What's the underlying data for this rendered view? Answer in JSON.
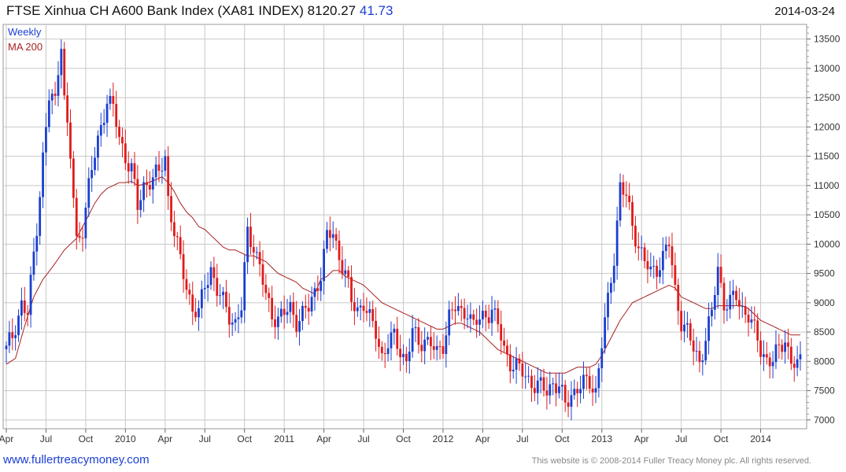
{
  "header": {
    "title": "FTSE Xinhua CH A600 Bank Index (XA81 INDEX) 8120.27",
    "change": "41.73",
    "date": "2014-03-24"
  },
  "footer": {
    "link": "www.fullertreacymoney.com",
    "copyright": "This website is © 2008-2014 Fuller Treacy Money plc. All rights reserved."
  },
  "colors": {
    "up": "#1a3fd0",
    "down": "#e01b1b",
    "ma": "#a82020",
    "grid": "#c8c8c8"
  },
  "chart_data": {
    "type": "line",
    "legend": [
      "Weekly",
      "MA 200"
    ],
    "legend_position": "top-left",
    "grid": true,
    "ylim": [
      6850,
      13750
    ],
    "y_ticks": [
      7000,
      7500,
      8000,
      8500,
      9000,
      9500,
      10000,
      10500,
      11000,
      11500,
      12000,
      12500,
      13000,
      13500
    ],
    "x_labels": [
      "Apr",
      "Jul",
      "Oct",
      "2010",
      "Apr",
      "Jul",
      "Oct",
      "2011",
      "Apr",
      "Jul",
      "Oct",
      "2012",
      "Apr",
      "Jul",
      "Oct",
      "2013",
      "Apr",
      "Jul",
      "Oct",
      "2014"
    ],
    "x_label_weeks": [
      0,
      13,
      26,
      39,
      52,
      65,
      78,
      91,
      104,
      117,
      130,
      143,
      156,
      169,
      182,
      195,
      208,
      221,
      234,
      247
    ],
    "weeks_total": 261,
    "series": [
      {
        "name": "Weekly",
        "anchors": [
          [
            0,
            8200
          ],
          [
            2,
            8400
          ],
          [
            5,
            9000
          ],
          [
            7,
            8800
          ],
          [
            10,
            10300
          ],
          [
            12,
            11500
          ],
          [
            14,
            12500
          ],
          [
            16,
            12400
          ],
          [
            17,
            13000
          ],
          [
            18,
            13500
          ],
          [
            19,
            12500
          ],
          [
            21,
            11500
          ],
          [
            23,
            10000
          ],
          [
            25,
            10300
          ],
          [
            27,
            11000
          ],
          [
            29,
            11500
          ],
          [
            31,
            12000
          ],
          [
            33,
            12500
          ],
          [
            35,
            12300
          ],
          [
            37,
            11800
          ],
          [
            39,
            11500
          ],
          [
            41,
            11300
          ],
          [
            43,
            10600
          ],
          [
            45,
            11000
          ],
          [
            47,
            11100
          ],
          [
            50,
            11200
          ],
          [
            52,
            11500
          ],
          [
            53,
            10800
          ],
          [
            55,
            10200
          ],
          [
            57,
            9700
          ],
          [
            59,
            9300
          ],
          [
            61,
            8900
          ],
          [
            63,
            8800
          ],
          [
            65,
            9300
          ],
          [
            67,
            9600
          ],
          [
            69,
            9200
          ],
          [
            71,
            9000
          ],
          [
            73,
            8800
          ],
          [
            75,
            8650
          ],
          [
            77,
            8900
          ],
          [
            79,
            10200
          ],
          [
            81,
            10000
          ],
          [
            83,
            9600
          ],
          [
            85,
            9100
          ],
          [
            87,
            8800
          ],
          [
            89,
            8750
          ],
          [
            91,
            8800
          ],
          [
            93,
            8900
          ],
          [
            95,
            8700
          ],
          [
            97,
            8800
          ],
          [
            99,
            8900
          ],
          [
            101,
            9200
          ],
          [
            103,
            9500
          ],
          [
            105,
            10100
          ],
          [
            107,
            10200
          ],
          [
            109,
            9800
          ],
          [
            111,
            9500
          ],
          [
            113,
            9000
          ],
          [
            115,
            8900
          ],
          [
            117,
            9000
          ],
          [
            119,
            8700
          ],
          [
            121,
            8500
          ],
          [
            123,
            8100
          ],
          [
            125,
            8300
          ],
          [
            127,
            8400
          ],
          [
            129,
            8200
          ],
          [
            131,
            8000
          ],
          [
            133,
            8500
          ],
          [
            135,
            8300
          ],
          [
            137,
            8400
          ],
          [
            139,
            8300
          ],
          [
            141,
            8100
          ],
          [
            143,
            8300
          ],
          [
            145,
            8800
          ],
          [
            147,
            8900
          ],
          [
            149,
            8800
          ],
          [
            151,
            8900
          ],
          [
            153,
            8600
          ],
          [
            155,
            8700
          ],
          [
            157,
            8800
          ],
          [
            159,
            8900
          ],
          [
            161,
            8600
          ],
          [
            163,
            8200
          ],
          [
            165,
            8000
          ],
          [
            167,
            7900
          ],
          [
            169,
            7800
          ],
          [
            171,
            7700
          ],
          [
            173,
            7600
          ],
          [
            175,
            7550
          ],
          [
            177,
            7500
          ],
          [
            179,
            7650
          ],
          [
            181,
            7550
          ],
          [
            183,
            7250
          ],
          [
            185,
            7450
          ],
          [
            187,
            7550
          ],
          [
            189,
            7600
          ],
          [
            191,
            7650
          ],
          [
            193,
            7500
          ],
          [
            195,
            8300
          ],
          [
            197,
            9000
          ],
          [
            199,
            9800
          ],
          [
            201,
            11000
          ],
          [
            203,
            10800
          ],
          [
            205,
            10300
          ],
          [
            207,
            10000
          ],
          [
            209,
            9700
          ],
          [
            211,
            9500
          ],
          [
            213,
            9600
          ],
          [
            215,
            9800
          ],
          [
            217,
            10000
          ],
          [
            219,
            9200
          ],
          [
            221,
            8700
          ],
          [
            223,
            8500
          ],
          [
            225,
            8200
          ],
          [
            227,
            8000
          ],
          [
            229,
            8400
          ],
          [
            231,
            8800
          ],
          [
            233,
            9600
          ],
          [
            235,
            9000
          ],
          [
            237,
            9000
          ],
          [
            239,
            9100
          ],
          [
            241,
            8900
          ],
          [
            243,
            8800
          ],
          [
            245,
            8500
          ],
          [
            247,
            8200
          ],
          [
            249,
            8050
          ],
          [
            251,
            8000
          ],
          [
            253,
            8200
          ],
          [
            255,
            8400
          ],
          [
            257,
            8000
          ],
          [
            259,
            7900
          ],
          [
            260,
            8120
          ]
        ],
        "wick": 240
      },
      {
        "name": "MA 200",
        "anchors": [
          [
            0,
            7950
          ],
          [
            3,
            8050
          ],
          [
            6,
            8600
          ],
          [
            9,
            9100
          ],
          [
            12,
            9400
          ],
          [
            15,
            9600
          ],
          [
            17,
            9750
          ],
          [
            19,
            9900
          ],
          [
            21,
            10000
          ],
          [
            23,
            10100
          ],
          [
            25,
            10300
          ],
          [
            27,
            10500
          ],
          [
            29,
            10700
          ],
          [
            31,
            10850
          ],
          [
            33,
            10950
          ],
          [
            35,
            11000
          ],
          [
            37,
            11050
          ],
          [
            39,
            11050
          ],
          [
            41,
            11070
          ],
          [
            43,
            11000
          ],
          [
            45,
            11020
          ],
          [
            47,
            11060
          ],
          [
            49,
            11100
          ],
          [
            51,
            11150
          ],
          [
            53,
            11050
          ],
          [
            55,
            10900
          ],
          [
            57,
            10700
          ],
          [
            59,
            10550
          ],
          [
            61,
            10450
          ],
          [
            63,
            10300
          ],
          [
            65,
            10250
          ],
          [
            67,
            10150
          ],
          [
            69,
            10050
          ],
          [
            71,
            9950
          ],
          [
            73,
            9900
          ],
          [
            75,
            9900
          ],
          [
            77,
            9850
          ],
          [
            79,
            9800
          ],
          [
            81,
            9800
          ],
          [
            83,
            9750
          ],
          [
            85,
            9700
          ],
          [
            87,
            9600
          ],
          [
            89,
            9500
          ],
          [
            91,
            9450
          ],
          [
            93,
            9400
          ],
          [
            95,
            9350
          ],
          [
            97,
            9250
          ],
          [
            99,
            9200
          ],
          [
            101,
            9150
          ],
          [
            103,
            9400
          ],
          [
            105,
            9450
          ],
          [
            107,
            9550
          ],
          [
            109,
            9550
          ],
          [
            111,
            9450
          ],
          [
            113,
            9400
          ],
          [
            115,
            9350
          ],
          [
            117,
            9300
          ],
          [
            119,
            9200
          ],
          [
            121,
            9100
          ],
          [
            123,
            9000
          ],
          [
            125,
            8950
          ],
          [
            127,
            8900
          ],
          [
            129,
            8850
          ],
          [
            131,
            8800
          ],
          [
            133,
            8750
          ],
          [
            135,
            8700
          ],
          [
            137,
            8650
          ],
          [
            139,
            8600
          ],
          [
            141,
            8550
          ],
          [
            143,
            8550
          ],
          [
            145,
            8600
          ],
          [
            147,
            8650
          ],
          [
            149,
            8650
          ],
          [
            151,
            8600
          ],
          [
            153,
            8550
          ],
          [
            155,
            8500
          ],
          [
            157,
            8400
          ],
          [
            159,
            8300
          ],
          [
            161,
            8200
          ],
          [
            163,
            8150
          ],
          [
            165,
            8100
          ],
          [
            167,
            8050
          ],
          [
            169,
            8000
          ],
          [
            171,
            7950
          ],
          [
            173,
            7900
          ],
          [
            175,
            7850
          ],
          [
            177,
            7800
          ],
          [
            179,
            7800
          ],
          [
            181,
            7800
          ],
          [
            183,
            7800
          ],
          [
            185,
            7850
          ],
          [
            187,
            7900
          ],
          [
            189,
            7900
          ],
          [
            191,
            7900
          ],
          [
            193,
            7950
          ],
          [
            195,
            8100
          ],
          [
            197,
            8300
          ],
          [
            199,
            8500
          ],
          [
            201,
            8700
          ],
          [
            203,
            8850
          ],
          [
            205,
            9000
          ],
          [
            207,
            9050
          ],
          [
            209,
            9100
          ],
          [
            211,
            9150
          ],
          [
            213,
            9200
          ],
          [
            215,
            9250
          ],
          [
            217,
            9300
          ],
          [
            219,
            9250
          ],
          [
            221,
            9100
          ],
          [
            223,
            9050
          ],
          [
            225,
            9000
          ],
          [
            227,
            8950
          ],
          [
            229,
            8900
          ],
          [
            231,
            8900
          ],
          [
            233,
            8950
          ],
          [
            235,
            8950
          ],
          [
            237,
            8950
          ],
          [
            239,
            8950
          ],
          [
            241,
            8950
          ],
          [
            243,
            8900
          ],
          [
            245,
            8800
          ],
          [
            247,
            8700
          ],
          [
            249,
            8650
          ],
          [
            251,
            8600
          ],
          [
            253,
            8550
          ],
          [
            255,
            8500
          ],
          [
            257,
            8450
          ],
          [
            259,
            8450
          ],
          [
            260,
            8450
          ]
        ]
      }
    ]
  }
}
